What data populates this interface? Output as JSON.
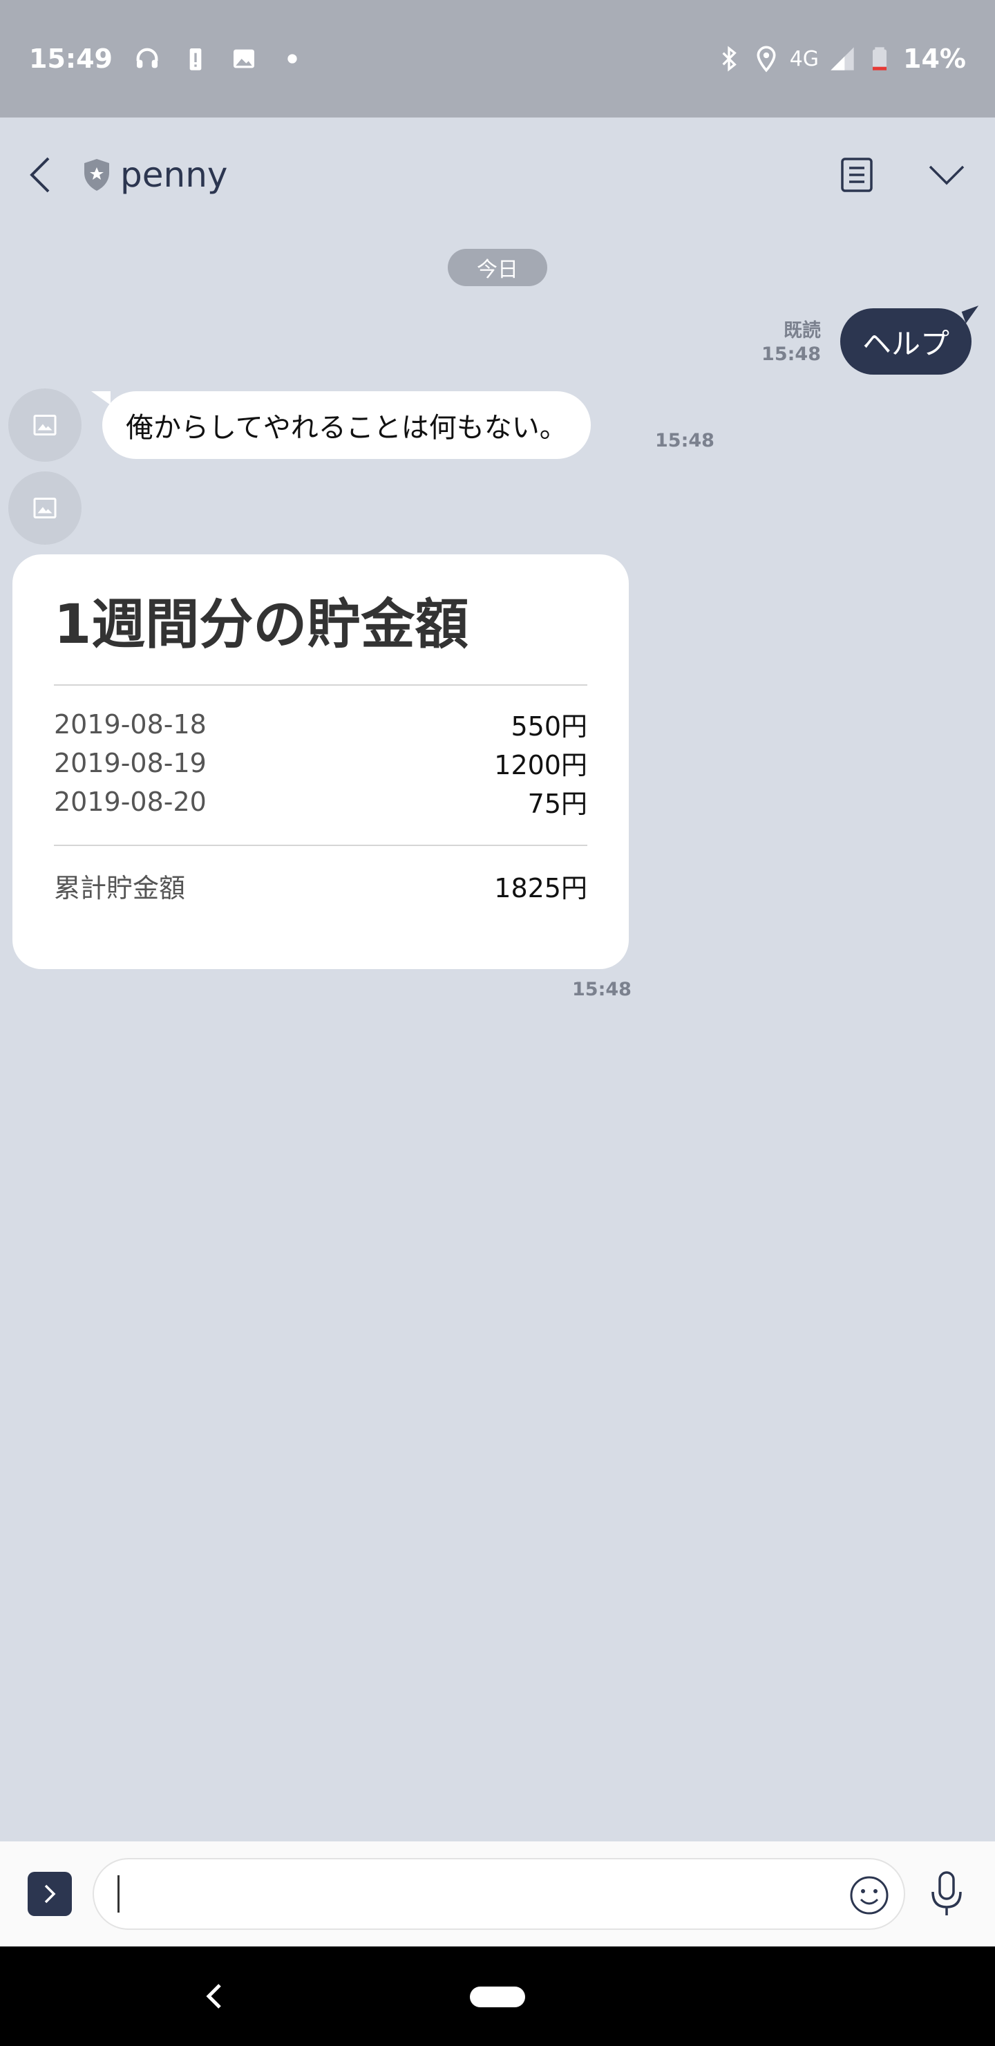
{
  "status_bar": {
    "time": "15:49",
    "network": "4G",
    "battery": "14%",
    "icons_left": [
      "headset-icon",
      "battery-alert-icon",
      "image-icon",
      "dot-icon"
    ],
    "icons_right": [
      "bluetooth-icon",
      "location-icon",
      "signal-icon",
      "battery-icon"
    ]
  },
  "header": {
    "title": "penny"
  },
  "chat": {
    "date_label": "今日",
    "outgoing": {
      "read_label": "既読",
      "time": "15:48",
      "text": "ヘルプ"
    },
    "incoming": {
      "text": "俺からしてやれることは何もない。",
      "time": "15:48"
    },
    "card": {
      "title": "1週間分の貯金額",
      "rows": [
        {
          "date": "2019-08-18",
          "amount": "550円"
        },
        {
          "date": "2019-08-19",
          "amount": "1200円"
        },
        {
          "date": "2019-08-20",
          "amount": "75円"
        }
      ],
      "total_label": "累計貯金額",
      "total_amount": "1825円",
      "time": "15:48"
    }
  },
  "input": {
    "value": ""
  },
  "colors": {
    "background": "#d7dce5",
    "accent": "#2c3650",
    "status_bar": "#a9adb6"
  }
}
